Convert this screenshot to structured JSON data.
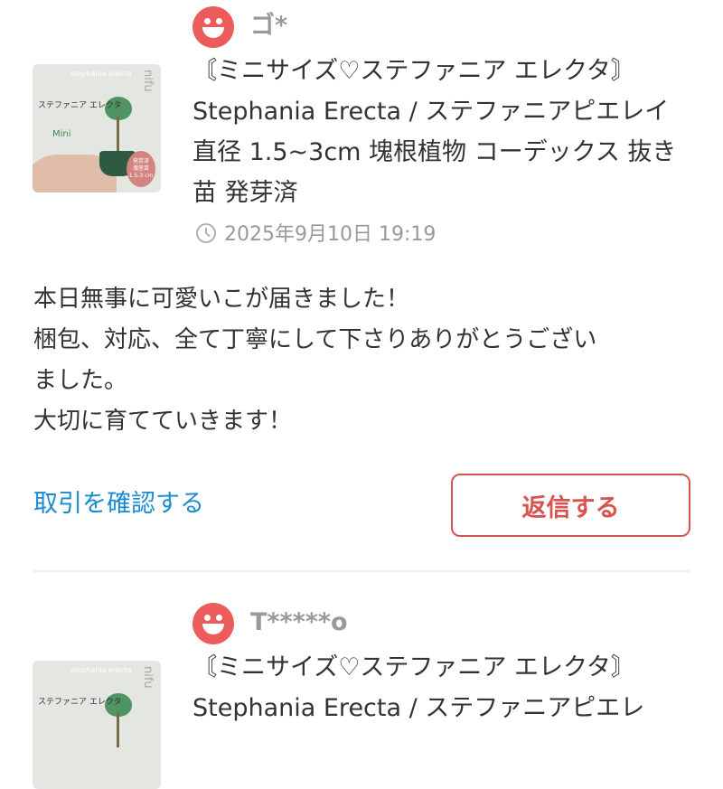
{
  "reviews": [
    {
      "username": "ゴ*",
      "product_title": "〘ミニサイズ♡ステファニア エレクタ〙 Stephania Erecta / ステファニアピエレイ 直径 1.5~3cm 塊根植物 コーデックス 抜き苗 発芽済",
      "date": "2025年9月10日 19:19",
      "comment_lines": [
        "本日無事に可愛いこが届きました！",
        "梱包、対応、全て丁寧にして下さりありがとうござい",
        "ました。",
        "大切に育てていきます！"
      ],
      "confirm_link": "取引を確認する",
      "reply_button": "返信する",
      "thumbnail": {
        "script_text": "stephania erecta",
        "brand": "nifu",
        "label": "ステファニア エレクタ",
        "mini": "Mini",
        "tag": "発芽済\n塊茎苗\n1.5-3 cm"
      }
    },
    {
      "username": "T*****o",
      "product_title": "〘ミニサイズ♡ステファニア エレクタ〙 Stephania Erecta / ステファニアピエレ",
      "thumbnail": {
        "script_text": "stephania erecta",
        "brand": "nifu",
        "label": "ステファニア エレクタ"
      }
    }
  ],
  "icons": {
    "avatar": "smiley-face-icon",
    "date": "clock-icon"
  },
  "colors": {
    "avatar": "#ec5c5c",
    "link": "#1a8ad3",
    "reply_button": "#d8534f",
    "muted_text": "#999999"
  }
}
